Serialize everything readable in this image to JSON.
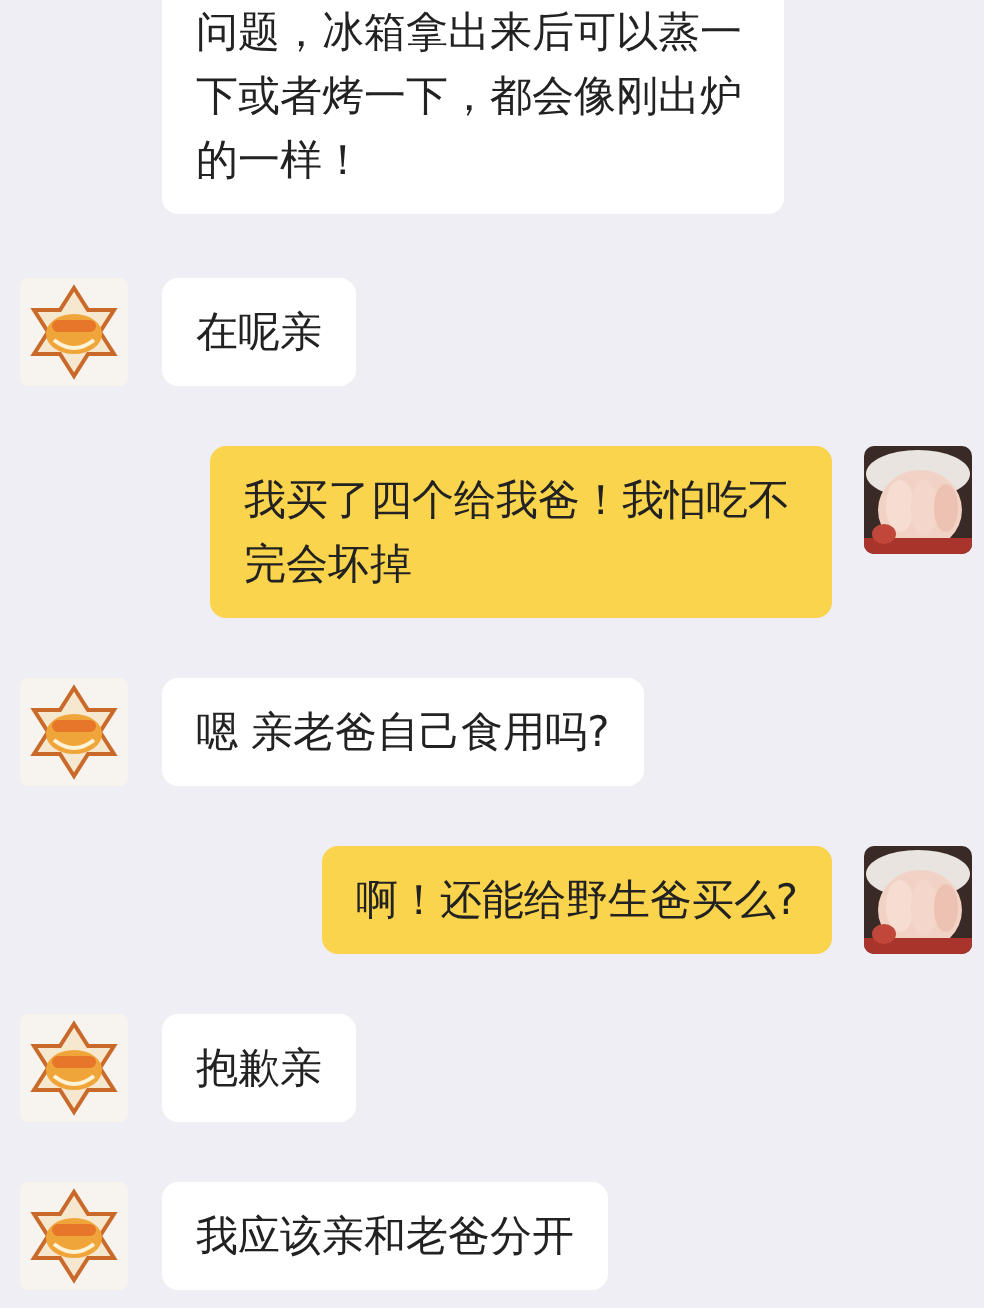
{
  "messages": [
    {
      "kind": "left",
      "show_avatar": false,
      "text": "问题，冰箱拿出来后可以蒸一下或者烤一下，都会像刚出炉的一样！"
    },
    {
      "kind": "left",
      "show_avatar": true,
      "text": "在呢亲"
    },
    {
      "kind": "right",
      "show_avatar": true,
      "text": "我买了四个给我爸！我怕吃不完会坏掉"
    },
    {
      "kind": "left",
      "show_avatar": true,
      "text": "嗯 亲老爸自己食用吗?"
    },
    {
      "kind": "right",
      "show_avatar": true,
      "text": "啊！还能给野生爸买么?"
    },
    {
      "kind": "left",
      "show_avatar": true,
      "text": "抱歉亲"
    },
    {
      "kind": "left",
      "show_avatar": true,
      "text": "我应该亲和老爸分开"
    }
  ]
}
